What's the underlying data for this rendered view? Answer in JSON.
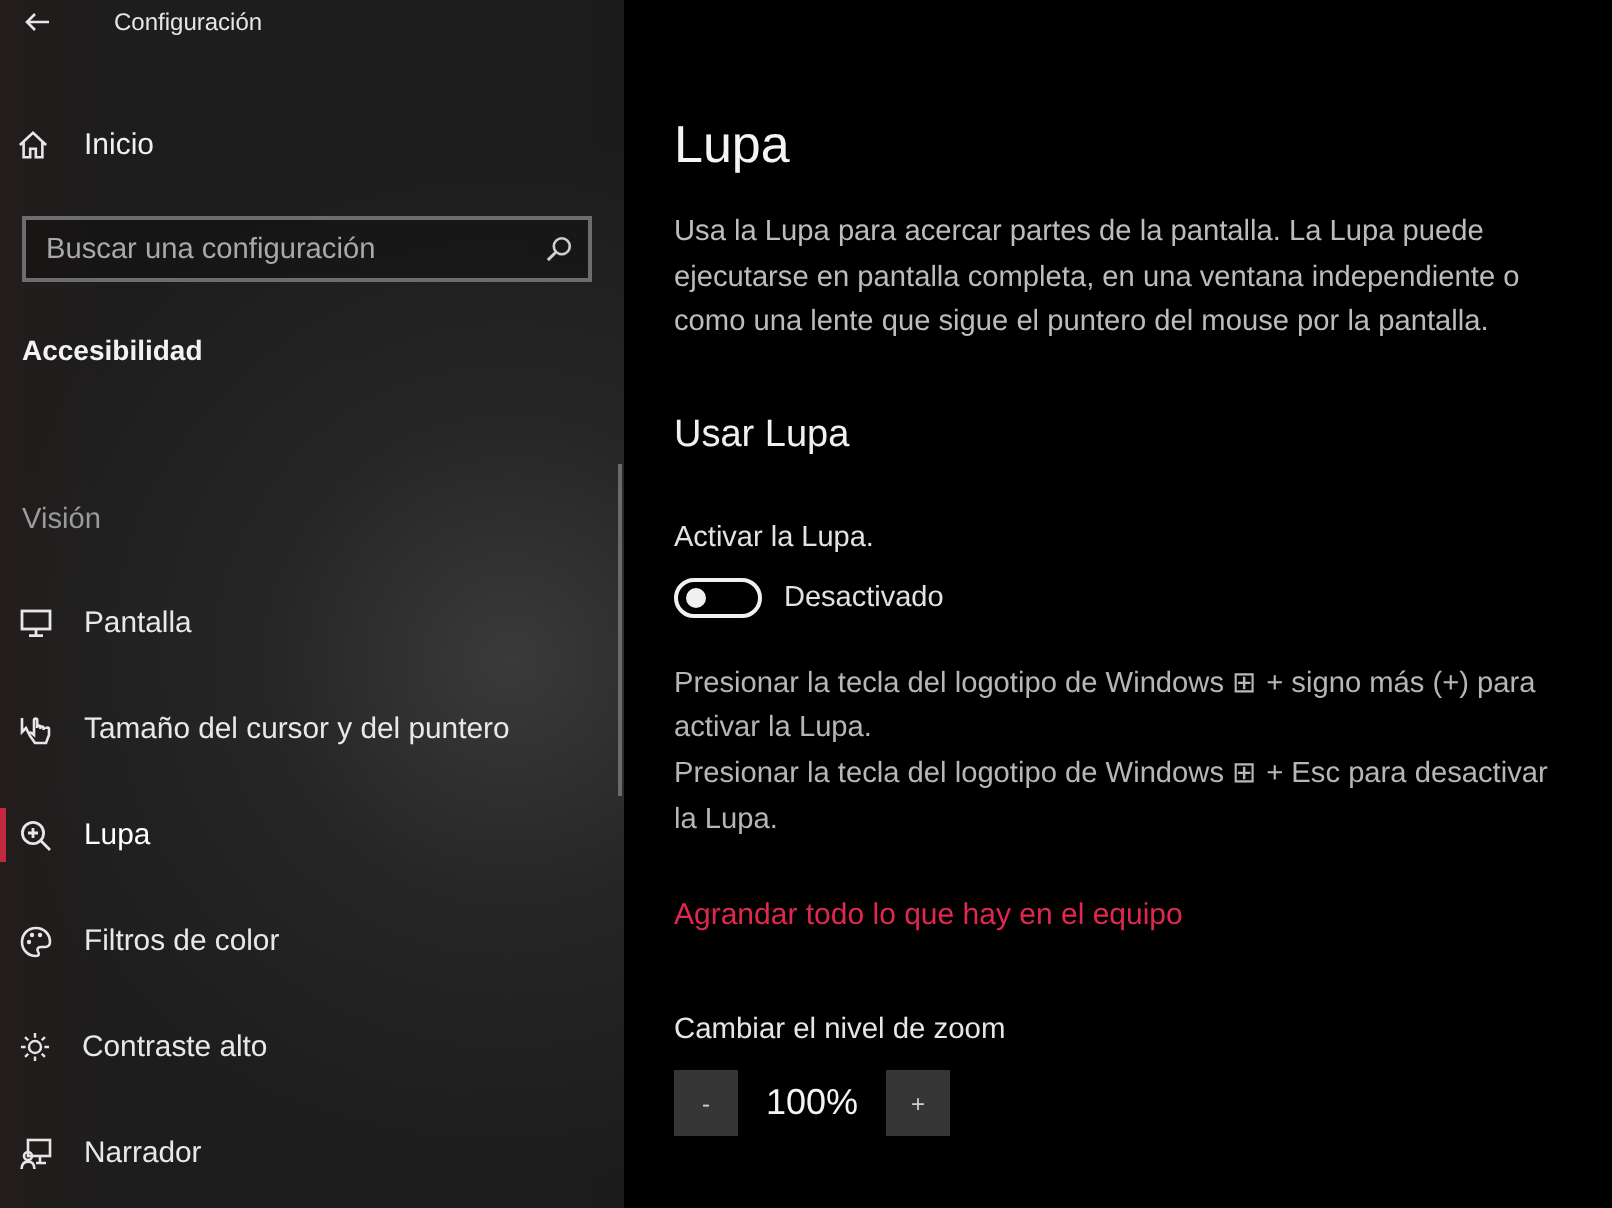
{
  "window": {
    "title": "Configuración"
  },
  "sidebar": {
    "home": "Inicio",
    "search": {
      "placeholder": "Buscar una configuración"
    },
    "section": "Accesibilidad",
    "group": {
      "heading": "Visión",
      "items": [
        {
          "label": "Pantalla",
          "selected": false
        },
        {
          "label": "Tamaño del cursor y del puntero",
          "selected": false
        },
        {
          "label": "Lupa",
          "selected": true
        },
        {
          "label": "Filtros de color",
          "selected": false
        },
        {
          "label": "Contraste alto",
          "selected": false
        },
        {
          "label": "Narrador",
          "selected": false
        }
      ]
    }
  },
  "page": {
    "title": "Lupa",
    "description": "Usa la Lupa para acercar partes de la pantalla. La Lupa puede ejecutarse en pantalla completa, en una ventana independiente o como una lente que sigue el puntero del mouse por la pantalla.",
    "section_title": "Usar Lupa",
    "toggle": {
      "label": "Activar la Lupa.",
      "on": false,
      "state_text": "Desactivado"
    },
    "hints": [
      "Presionar la tecla del logotipo de Windows ⊞ + signo más (+) para activar la Lupa.",
      "Presionar la tecla del logotipo de Windows ⊞ + Esc para desactivar la Lupa."
    ],
    "link": "Agrandar todo lo que hay en el equipo",
    "zoom": {
      "label": "Cambiar el nivel de zoom",
      "decrease": "-",
      "value": "100%",
      "increase": "+"
    }
  }
}
